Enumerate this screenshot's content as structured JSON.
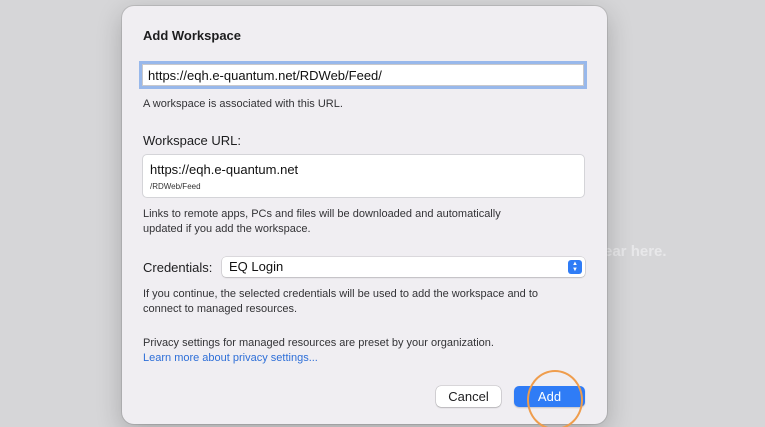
{
  "background": {
    "hint_text": "ear here."
  },
  "dialog": {
    "title": "Add Workspace",
    "url_input": {
      "value": "https://eqh.e-quantum.net/RDWeb/Feed/"
    },
    "url_hint": "A workspace is associated with this URL.",
    "workspace_url": {
      "label": "Workspace URL:",
      "host": "https://eqh.e-quantum.net",
      "path": "/RDWeb/Feed"
    },
    "download_hint_line1": "Links to remote apps, PCs and files will be downloaded and automatically",
    "download_hint_line2": "updated if you add the workspace.",
    "credentials": {
      "label": "Credentials:",
      "selected": "EQ Login"
    },
    "credentials_hint_line1": "If you continue, the selected credentials will be used to add the workspace and to",
    "credentials_hint_line2": "connect to managed resources.",
    "privacy_text": "Privacy settings for managed resources are preset by your organization.",
    "privacy_link": "Learn more about privacy settings...",
    "buttons": {
      "cancel": "Cancel",
      "add": "Add"
    }
  },
  "colors": {
    "accent": "#2f7cf6",
    "link": "#2e6fd8",
    "highlight_ring": "#ef9d4d",
    "dialog_background": "#f0eef2"
  },
  "icons": {
    "credentials_select": "chevron-up-down-icon"
  }
}
